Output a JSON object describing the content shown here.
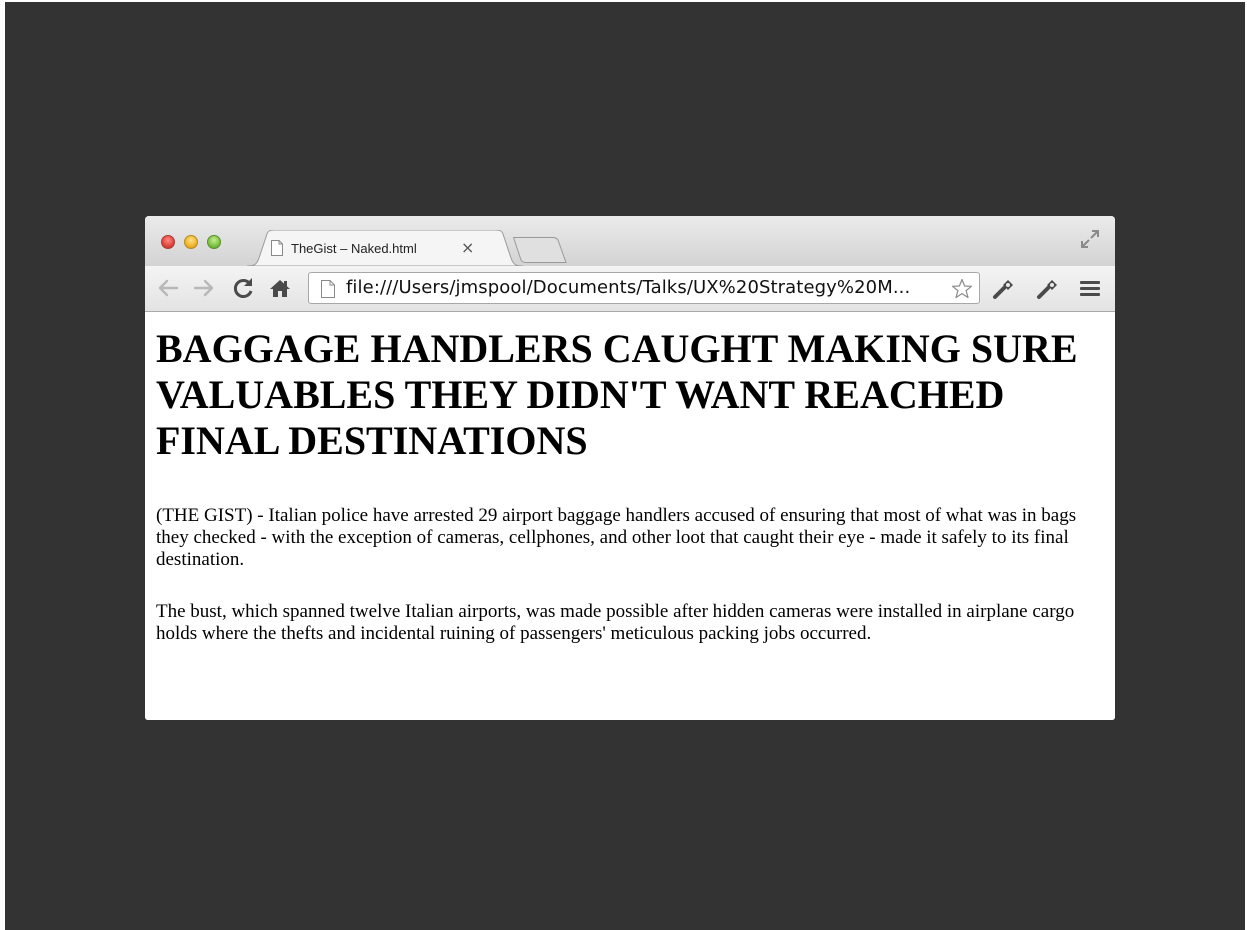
{
  "browser": {
    "tab": {
      "title": "TheGist – Naked.html",
      "close_glyph": "×"
    },
    "address": {
      "url": "file:///Users/jmspool/Documents/Talks/UX%20Strategy%20M..."
    },
    "icons": {
      "back": "back-arrow-icon",
      "forward": "forward-arrow-icon",
      "reload": "reload-icon",
      "home": "home-icon",
      "page": "document-icon",
      "bookmark": "star-icon",
      "extension_1": "wrench-icon",
      "extension_2": "wrench-icon",
      "menu": "hamburger-menu-icon",
      "fullscreen": "fullscreen-icon"
    },
    "colors": {
      "backdrop": "#333333",
      "toolbar": "#e8e8e8",
      "close": "#e0443e",
      "minimize": "#f0b429",
      "zoom": "#7bc043"
    }
  },
  "article": {
    "headline": "BAGGAGE HANDLERS CAUGHT MAKING SURE VALUABLES THEY DIDN'T WANT REACHED FINAL DESTINATIONS",
    "paragraphs": [
      "(THE GIST) - Italian police have arrested 29 airport baggage handlers accused of ensuring that most of what was in bags they checked - with the exception of cameras, cellphones, and other loot that caught their eye - made it safely to its final destination.",
      "The bust, which spanned twelve Italian airports, was made possible after hidden cameras were installed in airplane cargo holds where the thefts and incidental ruining of passengers' meticulous packing jobs occurred."
    ]
  }
}
